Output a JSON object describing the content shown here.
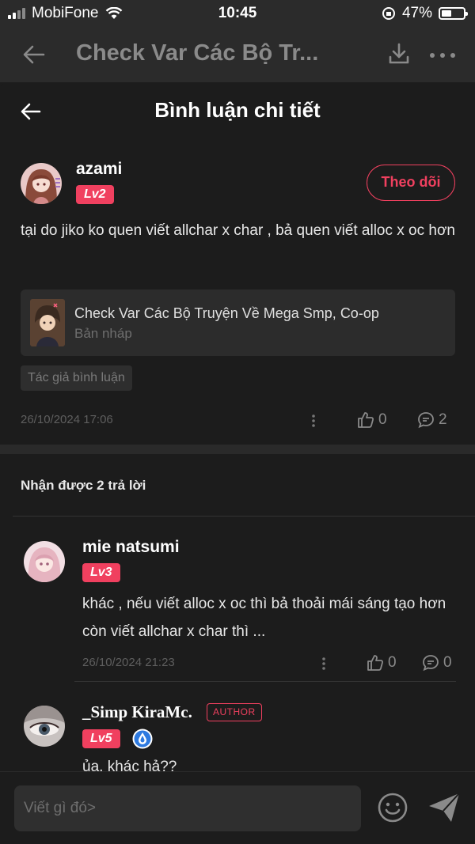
{
  "status_bar": {
    "carrier": "MobiFone",
    "time": "10:45",
    "battery": "47%"
  },
  "background_header": {
    "title": "Check Var Các Bộ Tr..."
  },
  "sheet": {
    "title": "Bình luận chi tiết"
  },
  "main_comment": {
    "username": "azami",
    "level": "Lv2",
    "follow_label": "Theo dõi",
    "text": "tại do jiko ko quen viết allchar x char , bả quen viết alloc x oc hơn",
    "story": {
      "name": "Check Var Các Bộ Truyện Về Mega Smp, Co-op",
      "status": "Bản nháp"
    },
    "tag": "Tác giả bình luận",
    "timestamp": "26/10/2024 17:06",
    "likes": "0",
    "replies": "2"
  },
  "replies_header": "Nhận được 2 trả lời",
  "replies": [
    {
      "username": "mie natsumi",
      "level": "Lv3",
      "text": "khác , nếu viết alloc x oc thì bả thoải mái sáng tạo hơn còn viết allchar x char thì ...",
      "timestamp": "26/10/2024 21:23",
      "likes": "0",
      "replies": "0"
    },
    {
      "username": "_Simp KiraMc.",
      "author_badge": "AUTHOR",
      "level": "Lv5",
      "text": "ủa, khác hả??"
    }
  ],
  "input": {
    "placeholder": "Viết gì đó>"
  },
  "colors": {
    "accent": "#f0405f",
    "background": "#1c1c1c",
    "card": "#2c2c2c"
  }
}
